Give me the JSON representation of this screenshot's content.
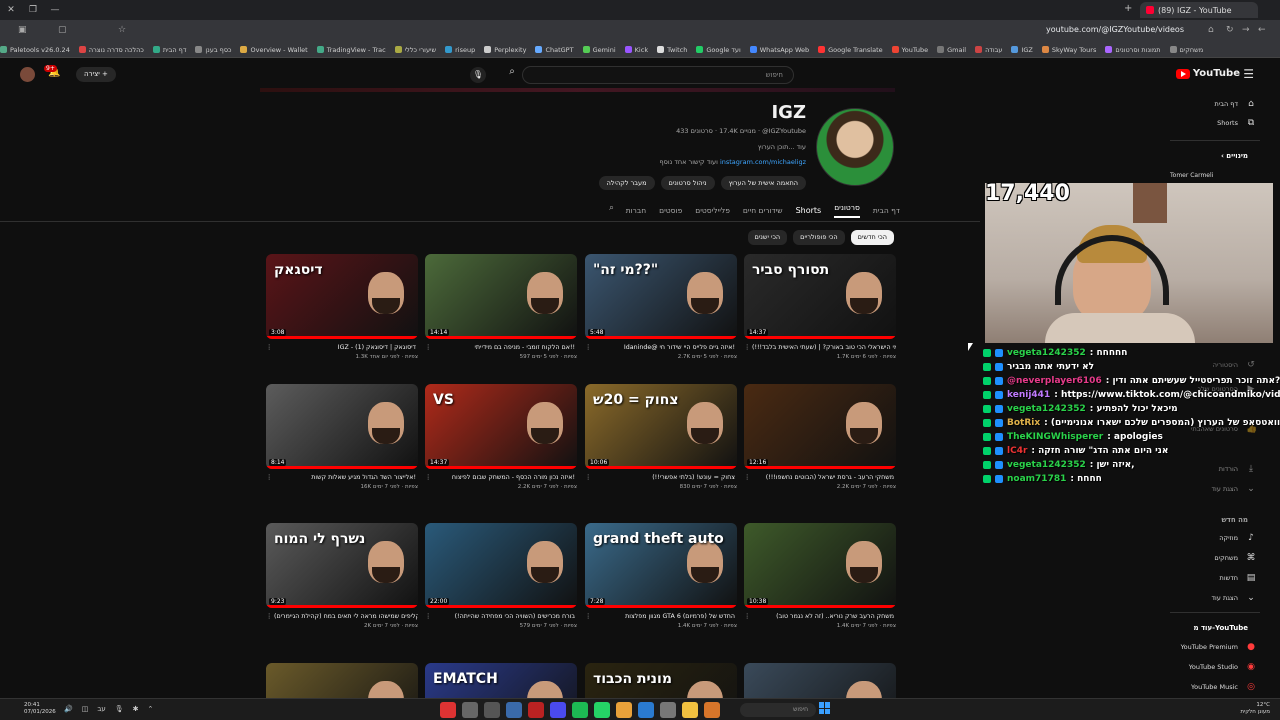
{
  "browser": {
    "tab_title": "(89) IGZ - YouTube",
    "url": "youtube.com/@IGZYoutube/videos",
    "bookmarks": [
      "Paletools v26.0.24",
      "כהלכה סדרה נוצרה",
      "דף הבית",
      "כסף בענן",
      "Overview - Wallet",
      "TradingView - Trac",
      "שיעורי כללי",
      "riseup",
      "Perplexity",
      "ChatGPT",
      "Gemini",
      "Kick",
      "Twitch",
      "Google ועד",
      "WhatsApp Web",
      "Google Translate",
      "YouTube",
      "Gmail",
      "עבודה",
      "IGZ",
      "SkyWay Tours",
      "תמונות וסרטונים",
      "משחקים"
    ]
  },
  "header": {
    "logo": "YouTube",
    "search_placeholder": "חיפוש",
    "create_label": "יצירה",
    "notif_count": "9+"
  },
  "channel": {
    "name": "IGZ",
    "handle": "@IGZYoutube",
    "meta": "433 סרטונים · ‎17.4K מנויים · @IGZYoutube",
    "description": "עוד ...תוכן הערוץ",
    "link_text": "instagram.com/michaeligz",
    "link_suffix": "ועוד קישור אחד נוסף",
    "buttons": [
      "התאמה אישית של הערוץ",
      "ניהול סרטונים",
      "מעבר לקהילה"
    ]
  },
  "tabs": [
    {
      "label": "דף הבית",
      "active": false
    },
    {
      "label": "סרטונים",
      "active": true
    },
    {
      "label": "Shorts",
      "active": false
    },
    {
      "label": "שידורים חיים",
      "active": false
    },
    {
      "label": "פלייליסטים",
      "active": false
    },
    {
      "label": "פוסטים",
      "active": false
    },
    {
      "label": "חברות",
      "active": false
    }
  ],
  "chips": [
    {
      "label": "הכי חדשים",
      "active": true
    },
    {
      "label": "הכי פופולריים",
      "active": false
    },
    {
      "label": "הכי ישנים",
      "active": false
    }
  ],
  "videos": [
    {
      "title": "מי הישראלי הכי טוב באורק? | (שעתי האישית בלבד!!!)",
      "meta": "1.7K צפיות · לפני 6 ימים",
      "duration": "14:37",
      "thumb_text": "תסורף סביר",
      "bg": "#2a2a2a"
    },
    {
      "title": "Idaninde@ איזה גיים פלייס היי שידור חי!",
      "meta": "2.7K צפיות · לפני 5 ימים",
      "duration": "5:48",
      "thumb_text": "\"מי זה??\"",
      "bg": "#3b5670"
    },
    {
      "title": "אם הלקוח זומבי - מניפה בם מידייתי!!",
      "meta": "597 צפיות · לפני 5 ימים",
      "duration": "14:14",
      "thumb_text": "",
      "bg": "#4c6a3a"
    },
    {
      "title": "IGZ - דיסוגאק | דיסוגאק (1)",
      "meta": "1.3K צפיות · לפני יום אחד",
      "duration": "3:08",
      "thumb_text": "דיסגאק",
      "bg": "#5a1418"
    },
    {
      "title": "משחקי הרעב - גרסת ישראל (הבוטים נחשפו!!!)",
      "meta": "2.2K צפיות · לפני 7 ימים",
      "duration": "12:16",
      "thumb_text": "",
      "bg": "#4a2a12"
    },
    {
      "title": "צחוק = עונש! (בלתי אפשרי!!)",
      "meta": "830 צפיות · לפני 7 ימים",
      "duration": "10:06",
      "thumb_text": "צחוק = 20ש",
      "bg": "#8a6a2a"
    },
    {
      "title": "איזה נכון מורה הכסף - המשחק שבום לפיצוח!",
      "meta": "2.2K צפיות · לפני 7 ימים",
      "duration": "14:37",
      "thumb_text": "VS",
      "bg": "#b02a1a"
    },
    {
      "title": "אלייצור השד הגדול מגיע שאלות קשות!",
      "meta": "16K צפיות · לפני 7 ימים",
      "duration": "8:14",
      "thumb_text": "",
      "bg": "#5c5c5c"
    },
    {
      "title": "משחק הרעב שרק נוריא.. (זה לא נגמר טוב)",
      "meta": "1.4K צפיות · לפני 7 ימים",
      "duration": "10:38",
      "thumb_text": "",
      "bg": "#3e5a2a"
    },
    {
      "title": "מגוון מפלצות GTA 6 החדש של (פרמיום)",
      "meta": "1.4K צפיות · לפני 7 ימים",
      "duration": "7:28",
      "thumb_text": "grand theft auto",
      "bg": "#3a6a8a"
    },
    {
      "title": "בורח מכרישים (השוויה הכי מפחידה שהייתה!)",
      "meta": "579 צפיות · לפני 7 ימים",
      "duration": "22:00",
      "thumb_text": "",
      "bg": "#2a5a7a"
    },
    {
      "title": "הקליפים שמישהו מראה לי תאים במח (קהילת הגיימרים)",
      "meta": "2K צפיות · לפני 7 ימים",
      "duration": "9:23",
      "thumb_text": "נשרף לי המוח",
      "bg": "#5a5a5a"
    },
    {
      "title": "",
      "meta": "",
      "duration": "",
      "thumb_text": "",
      "bg": "#3a4a5a"
    },
    {
      "title": "",
      "meta": "",
      "duration": "",
      "thumb_text": "מונית הכבוד",
      "bg": "#2a2410"
    },
    {
      "title": "",
      "meta": "",
      "duration": "",
      "thumb_text": "EMATCH",
      "bg": "#2a3a8a"
    },
    {
      "title": "",
      "meta": "",
      "duration": "",
      "thumb_text": "",
      "bg": "#6a5a2a"
    }
  ],
  "sidebar": {
    "home": "דף הבית",
    "shorts": "Shorts",
    "subs_title": "מינויים",
    "sub_user": "Tomer Carmeli",
    "you": "אתה",
    "history": "היסטוריה",
    "playlists": "פלייליסטים",
    "your_videos": "הסרטונים שלך",
    "liked": "סרטונים שאהבתי",
    "downloads": "הורדות",
    "more": "הצגת עוד",
    "explore_title": "מה חדש",
    "music": "מוזיקה",
    "gaming": "משחקים",
    "news": "חדשות",
    "show_more": "הצגת עוד",
    "more_from": "עוד מ-YouTube",
    "premium": "YouTube Premium",
    "studio": "YouTube Studio",
    "ytmusic": "YouTube Music"
  },
  "stream": {
    "viewer_count": "17,440",
    "chat": [
      {
        "user": "vegeta1242352",
        "msg": ": חחחחח",
        "color": "#2ad24a"
      },
      {
        "user": "",
        "msg": "לא ידעתי אתה מבגיר",
        "color": "#e33"
      },
      {
        "user": "@neverplayer6106",
        "msg": ": אתה זוכר תפריסטייל שעשיתם אתה ודין?",
        "color": "#e63b8a"
      },
      {
        "user": "kenij441",
        "msg": ": https://www.tiktok.com/@chicoandmiko/video",
        "color": "#c07aff"
      },
      {
        "user": "vegeta1242352",
        "msg": ": מיכאל יכול להפתיע",
        "color": "#2ad24a"
      },
      {
        "user": "BotRix",
        "msg": ": (המספרים שלכם ישארו אנונימיים) הוואטסאפ של הערוץ",
        "color": "#e0b24a"
      },
      {
        "user": "TheKINGWhisperer",
        "msg": ": apologies",
        "color": "#2ad24a"
      },
      {
        "user": "lC4r",
        "msg": ": אני היום אתה הדג\" שורה חזקה",
        "color": "#e33"
      },
      {
        "user": "vegeta1242352",
        "msg": ": איזה ישן,",
        "color": "#2ad24a"
      },
      {
        "user": "noam71781",
        "msg": ": חחחח",
        "color": "#2ad24a"
      }
    ]
  },
  "taskbar": {
    "time": "20:41",
    "date": "07/01/2026",
    "search": "חיפוש",
    "weather": "12°C",
    "weather_desc": "מעונן חלקית"
  }
}
